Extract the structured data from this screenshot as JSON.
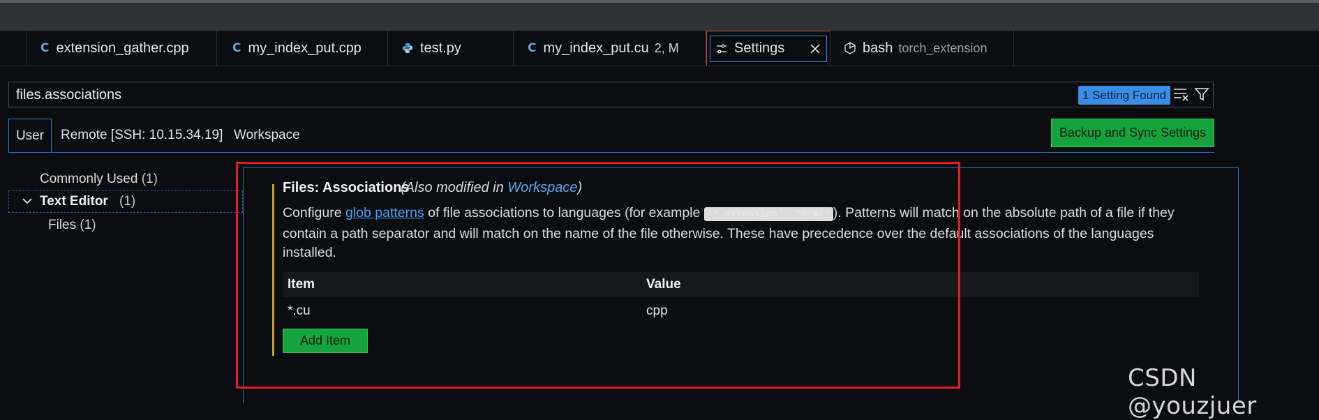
{
  "tabs": [
    {
      "label": "extension_gather.cpp",
      "icon": "cpp-icon",
      "description": ""
    },
    {
      "label": "my_index_put.cpp",
      "icon": "cpp-icon",
      "description": ""
    },
    {
      "label": "test.py",
      "icon": "python-icon",
      "description": ""
    },
    {
      "label": "my_index_put.cu",
      "icon": "cpp-icon",
      "description": "2, M"
    },
    {
      "label": "Settings",
      "icon": "settings-icon",
      "description": "",
      "active": true
    },
    {
      "label": "bash",
      "icon": "terminal-icon",
      "description": "torch_extension"
    }
  ],
  "search": {
    "value": "files.associations",
    "found_badge": "1 Setting Found"
  },
  "scopes": {
    "user": "User",
    "remote": "Remote [SSH: 10.15.34.19]",
    "workspace": "Workspace"
  },
  "sync_button": "Backup and Sync Settings",
  "toc": {
    "commonly_used": "Commonly Used",
    "commonly_used_count": "(1)",
    "text_editor": "Text Editor",
    "text_editor_count": "(1)",
    "files": "Files",
    "files_count": "(1)"
  },
  "setting": {
    "title": "Files: Associations",
    "modified_prefix": "(Also modified in ",
    "modified_link": "Workspace",
    "modified_suffix": ")",
    "desc_1": "Configure ",
    "desc_link": "glob patterns",
    "desc_2": " of file associations to languages (for example ",
    "desc_code": "\"*.extension\": \"html\"",
    "desc_3": "). Patterns will match on the absolute path of a file if they contain a path separator and will match on the name of the file otherwise. These have precedence over the default associations of the languages installed.",
    "table": {
      "headers": [
        "Item",
        "Value"
      ],
      "rows": [
        {
          "item": "*.cu",
          "value": "cpp"
        }
      ]
    },
    "add_item": "Add Item"
  },
  "watermark": "CSDN @youzjuer",
  "colors": {
    "accent": "#3c84d7",
    "button": "#15a33d",
    "highlight": "#e51c24",
    "focus_bar": "#d39c22"
  }
}
